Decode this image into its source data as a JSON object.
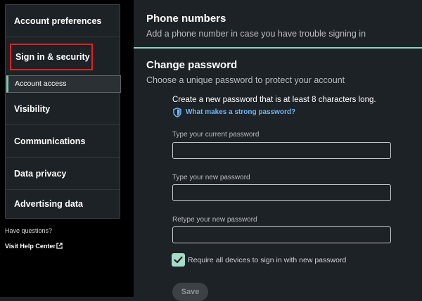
{
  "sidebar": {
    "items": [
      {
        "label": "Account preferences"
      },
      {
        "label": "Sign in & security"
      },
      {
        "label": "Visibility"
      },
      {
        "label": "Communications"
      },
      {
        "label": "Data privacy"
      },
      {
        "label": "Advertising data"
      }
    ],
    "sub_item": "Account access",
    "help_question": "Have questions?",
    "help_link": "Visit Help Center"
  },
  "main": {
    "phone": {
      "title": "Phone numbers",
      "subtitle": "Add a phone number in case you have trouble signing in"
    },
    "password": {
      "title": "Change password",
      "subtitle": "Choose a unique password to protect your account",
      "intro": "Create a new password that is at least 8 characters long.",
      "strong_link": "What makes a strong password?",
      "fields": [
        {
          "label": "Type your current password",
          "value": ""
        },
        {
          "label": "Type your new password",
          "value": ""
        },
        {
          "label": "Retype your new password",
          "value": ""
        }
      ],
      "checkbox": {
        "label": "Require all devices to sign in with new password",
        "checked": true
      },
      "save_label": "Save"
    }
  },
  "colors": {
    "accent": "#8fd3c1",
    "link": "#70b5f9",
    "highlight": "#e02020",
    "checkbox": "#a6dbc8"
  },
  "icons": {
    "shield": "shield-icon",
    "external": "external-link-icon",
    "check": "checkmark-icon"
  }
}
